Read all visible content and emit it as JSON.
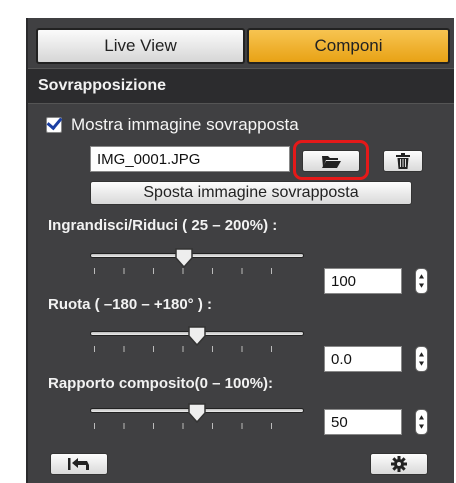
{
  "tabs": [
    {
      "label": "Live View",
      "active": false
    },
    {
      "label": "Componi",
      "active": true
    }
  ],
  "section": {
    "title": "Sovrapposizione"
  },
  "overlay": {
    "show_label": "Mostra immagine sovrapposta",
    "show_checked": true,
    "filename": "IMG_0001.JPG",
    "move_label": "Sposta immagine sovrapposta"
  },
  "sliders": {
    "zoom": {
      "label": "Ingrandisci/Riduci ( 25 – 200%) :",
      "value": "100",
      "min": 25,
      "max": 200,
      "current": 100
    },
    "rotate": {
      "label": "Ruota ( –180 – +180° ) :",
      "value": "0.0",
      "min": -180,
      "max": 180,
      "current": 0
    },
    "ratio": {
      "label": "Rapporto composito(0 – 100%):",
      "value": "50",
      "min": 0,
      "max": 100,
      "current": 50
    }
  },
  "icons": [
    "folder-open-icon",
    "trash-icon",
    "reset-arrow-icon",
    "gear-icon",
    "stepper-arrows-icon"
  ],
  "colors": {
    "accent": "#EBA81E",
    "highlight": "#E51919",
    "panel": "#404042"
  }
}
